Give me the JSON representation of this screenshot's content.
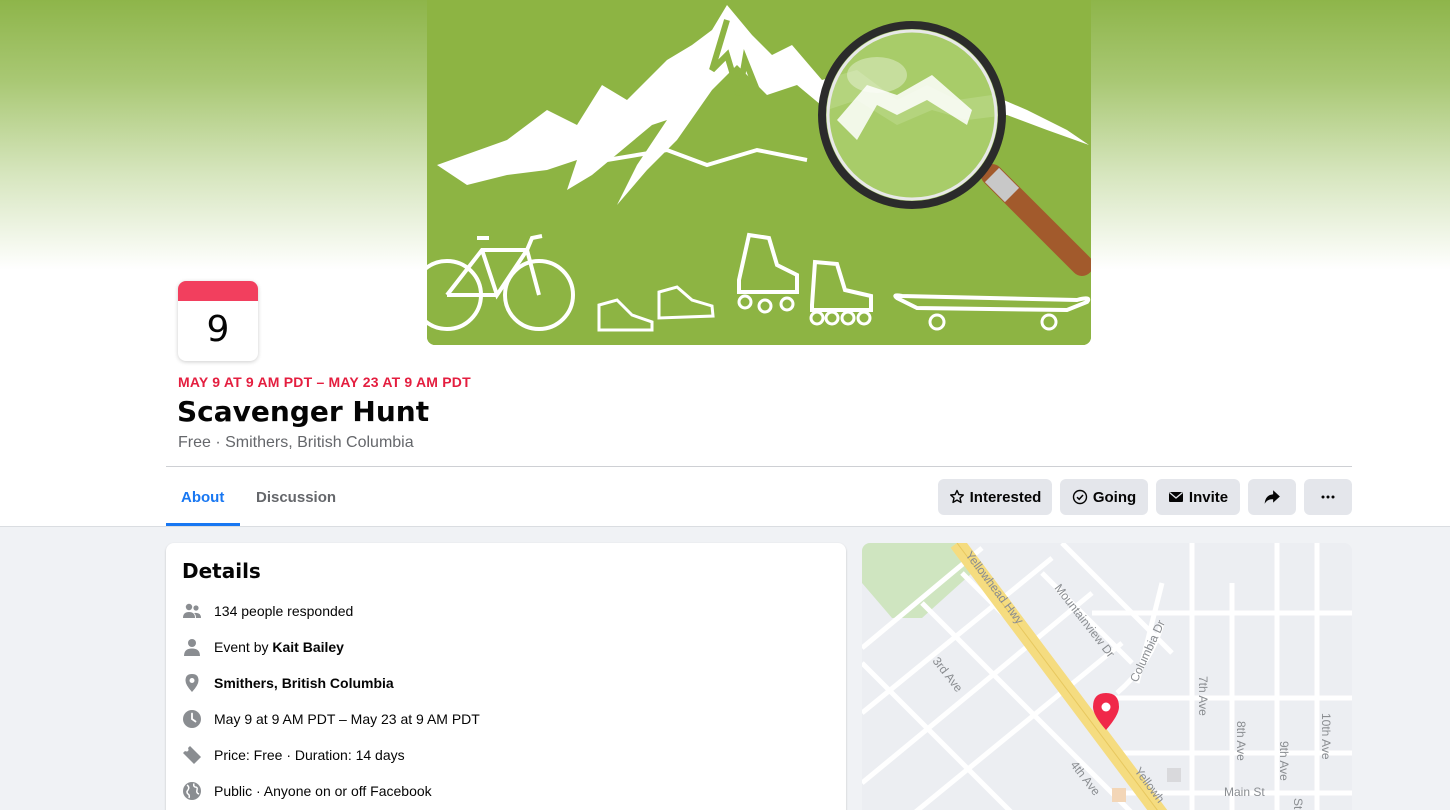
{
  "event": {
    "calendar_day": "9",
    "date_range": "MAY 9 AT 9 AM PDT – MAY 23 AT 9 AM PDT",
    "title": "Scavenger Hunt",
    "subtitle": "Free · Smithers, British Columbia"
  },
  "tabs": [
    {
      "label": "About",
      "active": true
    },
    {
      "label": "Discussion",
      "active": false
    }
  ],
  "actions": {
    "interested": "Interested",
    "going": "Going",
    "invite": "Invite",
    "share_icon": "share-arrow-icon",
    "more_icon": "more-dots-icon"
  },
  "details": {
    "heading": "Details",
    "responded": "134 people responded",
    "event_by_prefix": "Event by ",
    "event_by_name": "Kait Bailey",
    "location": "Smithers, British Columbia",
    "datetime": "May 9 at 9 AM PDT – May 23 at 9 AM PDT",
    "price_duration": "Price: Free · Duration: 14 days",
    "privacy": "Public · Anyone on or off Facebook"
  },
  "map": {
    "streets": [
      "Yellowhead Hwy",
      "Mountainview Dr",
      "Columbia Dr",
      "3rd Ave",
      "7th Ave",
      "8th Ave",
      "9th Ave",
      "10th Ave",
      "4th Ave",
      "Main St",
      "Yellowh",
      "St"
    ]
  },
  "colors": {
    "accent": "#1877f2",
    "date_red": "#e41e3f",
    "calendar_top": "#f23f5e",
    "cover_green": "#8db443",
    "map_pin": "#f02849",
    "highway": "#f5dc80"
  }
}
